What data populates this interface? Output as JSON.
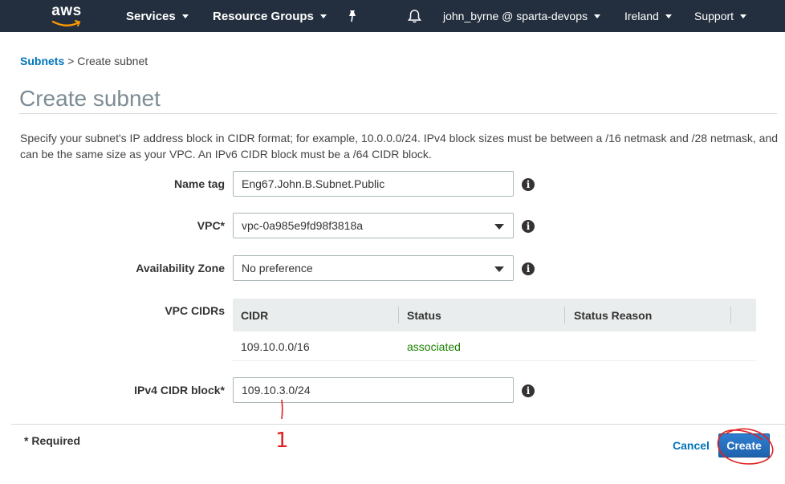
{
  "nav": {
    "logo": "aws",
    "services": "Services",
    "resource_groups": "Resource Groups",
    "pin_icon": "pin-icon",
    "bell_icon": "bell-icon",
    "account": "john_byrne @ sparta-devops",
    "region": "Ireland",
    "support": "Support"
  },
  "breadcrumb": {
    "parent": "Subnets",
    "separator": " > ",
    "current": "Create subnet"
  },
  "page": {
    "title": "Create subnet",
    "description": "Specify your subnet's IP address block in CIDR format; for example, 10.0.0.0/24. IPv4 block sizes must be between a /16 netmask and /28 netmask, and can be the same size as your VPC. An IPv6 CIDR block must be a /64 CIDR block."
  },
  "form": {
    "name_tag": {
      "label": "Name tag",
      "value": "Eng67.John.B.Subnet.Public"
    },
    "vpc": {
      "label": "VPC*",
      "value": "vpc-0a985e9fd98f3818a"
    },
    "az": {
      "label": "Availability Zone",
      "value": "No preference"
    },
    "vpc_cidrs": {
      "label": "VPC CIDRs",
      "columns": [
        "CIDR",
        "Status",
        "Status Reason"
      ],
      "rows": [
        {
          "cidr": "109.10.0.0/16",
          "status": "associated",
          "reason": ""
        }
      ]
    },
    "ipv4": {
      "label": "IPv4 CIDR block*",
      "value": "109.10.3.0/24"
    }
  },
  "footer": {
    "required": "* Required",
    "cancel": "Cancel",
    "create": "Create"
  },
  "annotation": {
    "mark": "1",
    "color": "#e02020"
  },
  "colors": {
    "nav_bg": "#232f3e",
    "link": "#0073bb",
    "primary_button": "#2e73b8",
    "status_ok": "#1d8102"
  }
}
